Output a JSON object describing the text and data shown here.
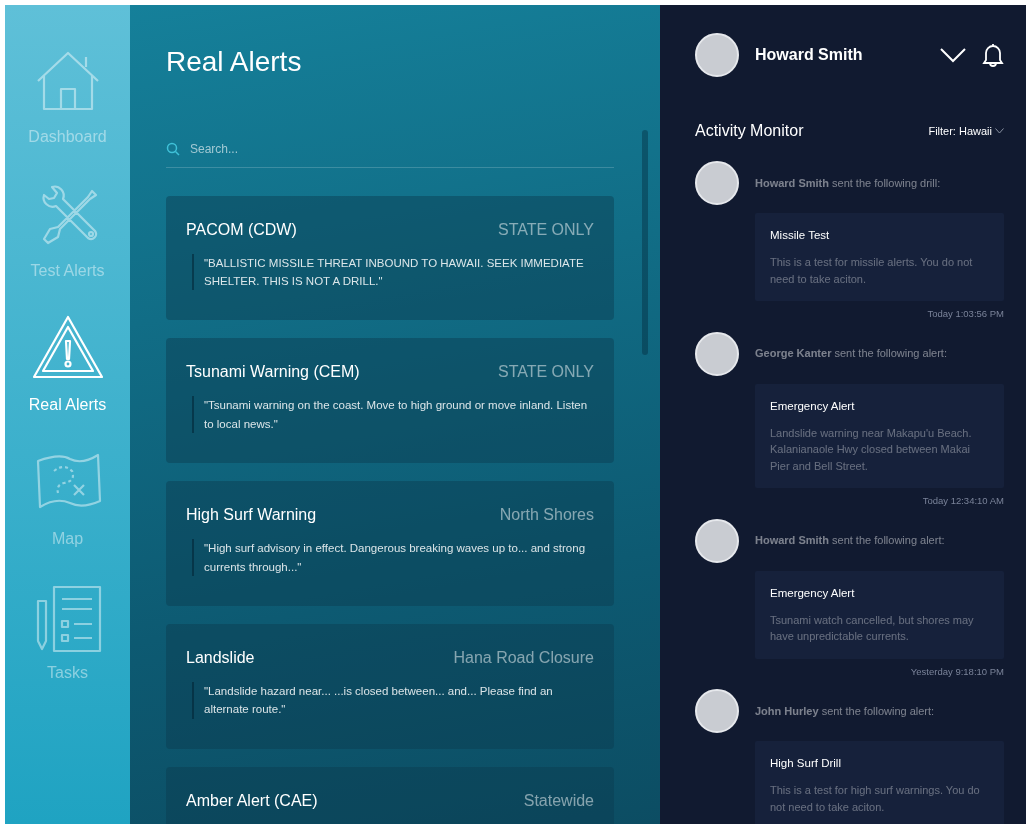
{
  "sidebar": {
    "items": [
      {
        "label": "Dashboard",
        "selected": false
      },
      {
        "label": "Test Alerts",
        "selected": false
      },
      {
        "label": "Real Alerts",
        "selected": true
      },
      {
        "label": "Map",
        "selected": false
      },
      {
        "label": "Tasks",
        "selected": false
      }
    ]
  },
  "alerts_panel": {
    "title": "Real Alerts",
    "search": {
      "placeholder": "Search..."
    },
    "alerts": [
      {
        "title": "PACOM (CDW)",
        "scope": "STATE ONLY",
        "message": "\"BALLISTIC MISSILE THREAT INBOUND TO HAWAII. SEEK IMMEDIATE SHELTER. THIS IS NOT A DRILL.\""
      },
      {
        "title": "Tsunami Warning (CEM)",
        "scope": "STATE ONLY",
        "message": "\"Tsunami warning on the coast. Move to high ground or move inland. Listen to local news.\""
      },
      {
        "title": "High Surf Warning",
        "scope": "North Shores",
        "message": "\"High surf advisory in effect. Dangerous breaking waves up to... and strong currents through...\""
      },
      {
        "title": "Landslide",
        "scope": "Hana Road Closure",
        "message": "\"Landslide hazard near... ...is closed between... and... Please find an alternate route.\""
      },
      {
        "title": "Amber Alert (CAE)",
        "scope": "Statewide"
      }
    ]
  },
  "user": {
    "name": "Howard Smith"
  },
  "activity_monitor": {
    "title": "Activity Monitor",
    "filter": "Filter: Hawaii",
    "entries": [
      {
        "message": "**Howard Smith** sent the following drill:",
        "title": "Missile Test",
        "body": "This is a test for missile alerts. You do not need to take aciton.",
        "time": "Today 1:03:56 PM"
      },
      {
        "message": "**George Kanter** sent the following alert:",
        "title": "Emergency Alert",
        "body": "Landslide warning near Makapu'u Beach. Kalanianaole Hwy closed between Makai Pier and Bell Street.",
        "time": "Today 12:34:10 AM"
      },
      {
        "message": "**Howard Smith** sent the following alert:",
        "title": "Emergency Alert",
        "body": "Tsunami watch cancelled, but shores may have unpredictable currents.",
        "time": "Yesterday 9:18:10 PM"
      },
      {
        "message": "**John Hurley** sent the following alert:",
        "title": "High Surf Drill",
        "body": "This is a test for high surf warnings. You do not need to take aciton."
      }
    ]
  }
}
